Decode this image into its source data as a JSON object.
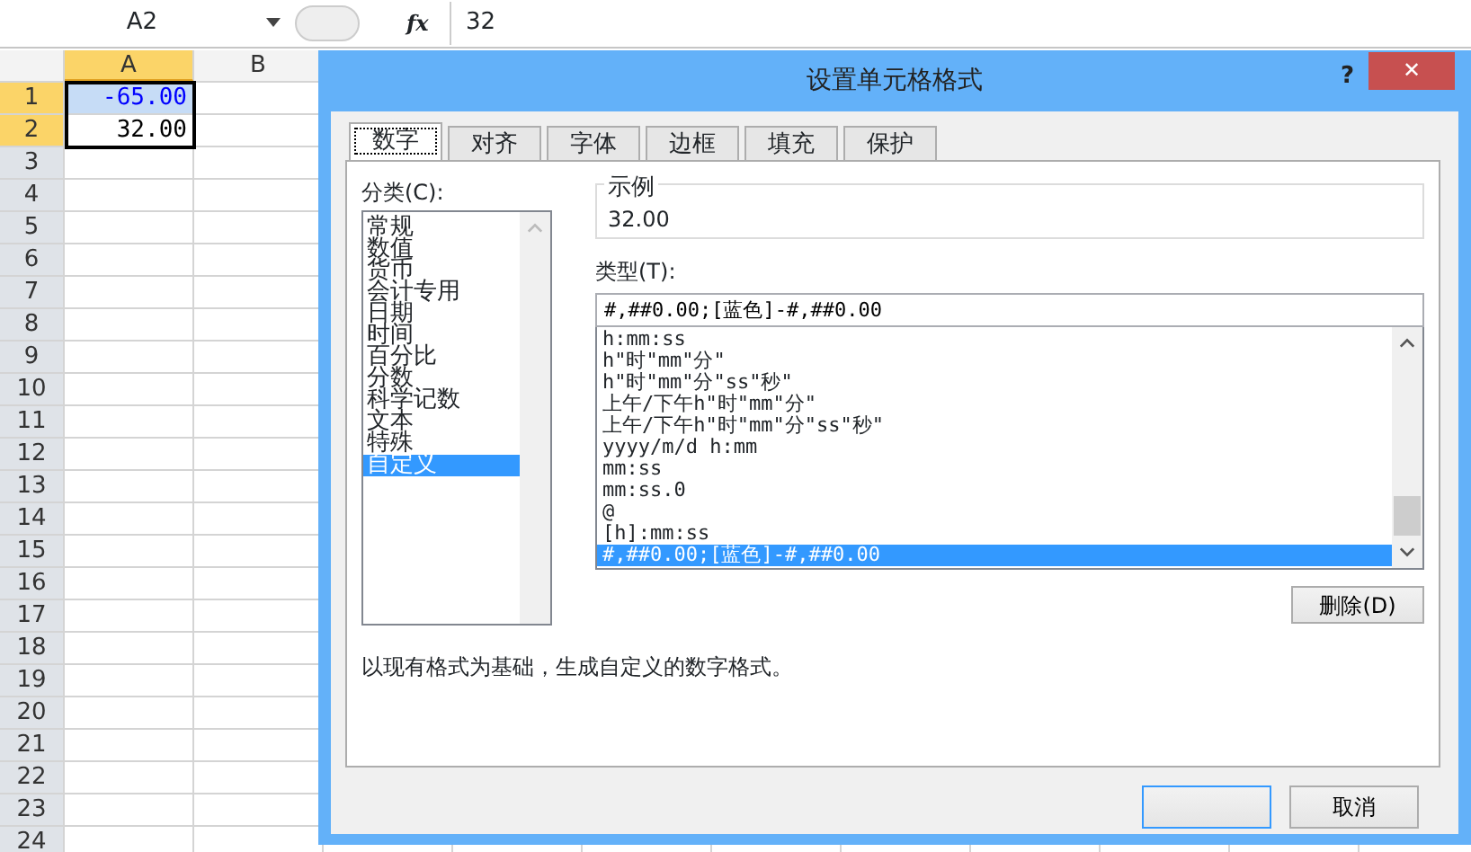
{
  "formula_bar": {
    "name_box": "A2",
    "function_label": "fx",
    "value": "32"
  },
  "sheet": {
    "columns": [
      {
        "label": "A",
        "selected": true
      },
      {
        "label": "B",
        "selected": false
      }
    ],
    "rows": [
      {
        "label": "1",
        "selected": true,
        "cells": [
          {
            "value": "-65.00",
            "color": "#0000ff",
            "selected": true,
            "active": false
          }
        ]
      },
      {
        "label": "2",
        "selected": true,
        "cells": [
          {
            "value": "32.00",
            "color": "#000000",
            "selected": true,
            "active": true
          }
        ]
      },
      {
        "label": "3",
        "selected": false
      },
      {
        "label": "4",
        "selected": false
      },
      {
        "label": "5",
        "selected": false
      },
      {
        "label": "6",
        "selected": false
      },
      {
        "label": "7",
        "selected": false
      },
      {
        "label": "8",
        "selected": false
      },
      {
        "label": "9",
        "selected": false
      },
      {
        "label": "10",
        "selected": false
      },
      {
        "label": "11",
        "selected": false
      },
      {
        "label": "12",
        "selected": false
      },
      {
        "label": "13",
        "selected": false
      },
      {
        "label": "14",
        "selected": false
      },
      {
        "label": "15",
        "selected": false
      },
      {
        "label": "16",
        "selected": false
      },
      {
        "label": "17",
        "selected": false
      },
      {
        "label": "18",
        "selected": false
      },
      {
        "label": "19",
        "selected": false
      },
      {
        "label": "20",
        "selected": false
      },
      {
        "label": "21",
        "selected": false
      },
      {
        "label": "22",
        "selected": false
      },
      {
        "label": "23",
        "selected": false
      },
      {
        "label": "24",
        "selected": false
      }
    ]
  },
  "dialog": {
    "title": "设置单元格格式",
    "help": "?",
    "close": "✕",
    "tabs": [
      {
        "label": "数字",
        "selected": true
      },
      {
        "label": "对齐",
        "selected": false
      },
      {
        "label": "字体",
        "selected": false
      },
      {
        "label": "边框",
        "selected": false
      },
      {
        "label": "填充",
        "selected": false
      },
      {
        "label": "保护",
        "selected": false
      }
    ],
    "category_label": "分类(C):",
    "categories": [
      {
        "label": "常规",
        "selected": false
      },
      {
        "label": "数值",
        "selected": false
      },
      {
        "label": "货币",
        "selected": false
      },
      {
        "label": "会计专用",
        "selected": false
      },
      {
        "label": "日期",
        "selected": false
      },
      {
        "label": "时间",
        "selected": false
      },
      {
        "label": "百分比",
        "selected": false
      },
      {
        "label": "分数",
        "selected": false
      },
      {
        "label": "科学记数",
        "selected": false
      },
      {
        "label": "文本",
        "selected": false
      },
      {
        "label": "特殊",
        "selected": false
      },
      {
        "label": "自定义",
        "selected": true
      }
    ],
    "sample_label": "示例",
    "sample_value": "32.00",
    "type_label": "类型(T):",
    "type_value": "#,##0.00;[蓝色]-#,##0.00",
    "formats": [
      {
        "label": "h:mm:ss",
        "selected": false
      },
      {
        "label": "h\"时\"mm\"分\"",
        "selected": false
      },
      {
        "label": "h\"时\"mm\"分\"ss\"秒\"",
        "selected": false
      },
      {
        "label": "上午/下午h\"时\"mm\"分\"",
        "selected": false
      },
      {
        "label": "上午/下午h\"时\"mm\"分\"ss\"秒\"",
        "selected": false
      },
      {
        "label": "yyyy/m/d h:mm",
        "selected": false
      },
      {
        "label": "mm:ss",
        "selected": false
      },
      {
        "label": "mm:ss.0",
        "selected": false
      },
      {
        "label": "@",
        "selected": false
      },
      {
        "label": "[h]:mm:ss",
        "selected": false
      },
      {
        "label": "#,##0.00;[蓝色]-#,##0.00",
        "selected": true
      }
    ],
    "delete_button": "删除(D)",
    "description": "以现有格式为基础，生成自定义的数字格式。",
    "cancel_button": "取消"
  }
}
